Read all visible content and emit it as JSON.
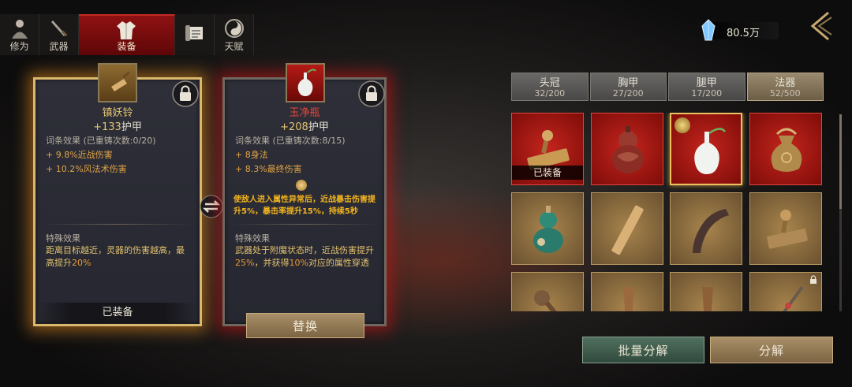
{
  "nav": {
    "tabs": [
      {
        "label": "修为",
        "icon": "cultivator-icon",
        "active": false
      },
      {
        "label": "武器",
        "icon": "sword-icon",
        "active": false
      },
      {
        "label": "装备",
        "icon": "robe-icon",
        "active": true
      },
      {
        "label": "",
        "icon": "scroll-icon",
        "active": false
      },
      {
        "label": "天赋",
        "icon": "bagua-icon",
        "active": false
      }
    ]
  },
  "currency": {
    "value": "80.5万",
    "icon": "crystal-icon"
  },
  "left_item": {
    "name": "镇妖铃",
    "armor_value": "+133",
    "armor_label": "护甲",
    "affix_title": "词条效果 (已重铸次数:0/20)",
    "stats": [
      "+ 9.8%近战伤害",
      "+ 10.2%风法术伤害"
    ],
    "special_title": "特殊效果",
    "special_text_a": "距离目标越近，灵器的伤害越高，最高提升",
    "special_hl": "20%",
    "equipped_label": "已装备"
  },
  "right_item": {
    "name": "玉净瓶",
    "armor_value": "+208",
    "armor_label": "护甲",
    "affix_title": "词条效果 (已重铸次数:8/15)",
    "stats": [
      "+ 8身法",
      "+ 8.3%最终伤害"
    ],
    "bonus": "使敌人进入属性异常后，近战暴击伤害提升5%，暴击率提升15%，持续5秒",
    "special_title": "特殊效果",
    "special_text_a": "武器处于附魔状态时，近战伤害提升",
    "special_hl1": "25%",
    "special_text_b": "，并获得",
    "special_hl2": "10%",
    "special_text_c": "对应的属性穿透",
    "replace_label": "替换"
  },
  "slot_tabs": [
    {
      "label": "头冠",
      "count": "32/200",
      "active": false
    },
    {
      "label": "胸甲",
      "count": "27/200",
      "active": false
    },
    {
      "label": "腿甲",
      "count": "17/200",
      "active": false
    },
    {
      "label": "法器",
      "count": "52/500",
      "active": true
    }
  ],
  "inventory": {
    "equipped_tag": "已装备",
    "cells": [
      {
        "icon": "stamp-icon",
        "rarity": "red",
        "equipped": true
      },
      {
        "icon": "gourd-red-icon",
        "rarity": "red"
      },
      {
        "icon": "jade-vase-icon",
        "rarity": "red",
        "selected": true
      },
      {
        "icon": "pouch-icon",
        "rarity": "red"
      },
      {
        "icon": "gourd-green-icon",
        "rarity": "gold"
      },
      {
        "icon": "bamboo-slip-icon",
        "rarity": "gold"
      },
      {
        "icon": "horn-icon",
        "rarity": "gold"
      },
      {
        "icon": "stamp-icon",
        "rarity": "gold"
      },
      {
        "icon": "ruyi-icon",
        "rarity": "gold"
      },
      {
        "icon": "club-icon",
        "rarity": "gold"
      },
      {
        "icon": "club-icon",
        "rarity": "gold"
      },
      {
        "icon": "staff-icon",
        "rarity": "gold",
        "locked": true
      }
    ]
  },
  "actions": {
    "batch_decompose": "批量分解",
    "decompose": "分解"
  },
  "colors": {
    "accent_red": "#8f1112",
    "gold": "#e3c270",
    "rarity_red": "#c4251d",
    "rarity_gold": "#a7844c"
  }
}
